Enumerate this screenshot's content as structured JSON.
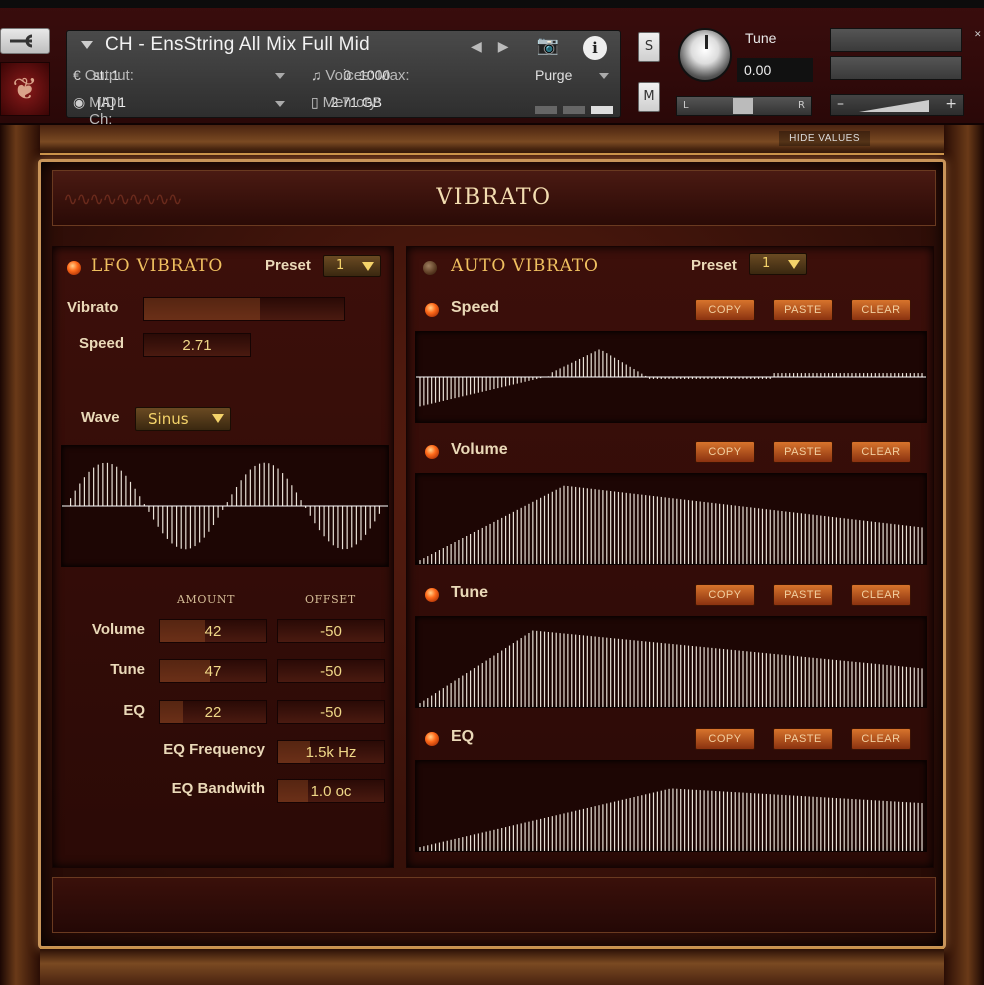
{
  "header": {
    "instrument_name": "CH - EnsString All Mix Full Mid",
    "output_label": "Output:",
    "output_value": "st. 1",
    "voices_label": "Voices:",
    "voices_value": "0",
    "max_label": "Max:",
    "max_value": "1000",
    "purge_label": "Purge",
    "midi_label": "MIDI Ch:",
    "midi_value": "[A]  1",
    "memory_label": "Memory:",
    "memory_value": "2.71 GB",
    "solo_label": "S",
    "mute_label": "M",
    "tune_label": "Tune",
    "tune_value": "0.00",
    "pan_left": "L",
    "pan_right": "R",
    "vol_minus": "–",
    "vol_plus": "+"
  },
  "hide_values_label": "HIDE VALUES",
  "page_title": "VIBRATO",
  "lfo": {
    "title": "LFO VIBRATO",
    "preset_label": "Preset",
    "preset_value": "1",
    "vibrato_label": "Vibrato",
    "vibrato_level": 0.58,
    "speed_label": "Speed",
    "speed_value": "2.71",
    "wave_label": "Wave",
    "wave_value": "Sinus",
    "amount_header": "AMOUNT",
    "offset_header": "OFFSET",
    "rows": [
      {
        "label": "Volume",
        "amount": "42",
        "offset": "-50"
      },
      {
        "label": "Tune",
        "amount": "47",
        "offset": "-50"
      },
      {
        "label": "EQ",
        "amount": "22",
        "offset": "-50"
      }
    ],
    "eq_freq_label": "EQ Frequency",
    "eq_freq_value": "1.5k Hz",
    "eq_bw_label": "EQ Bandwith",
    "eq_bw_value": "1.0 oc"
  },
  "auto": {
    "title": "AUTO VIBRATO",
    "preset_label": "Preset",
    "preset_value": "1",
    "copy_label": "COPY",
    "paste_label": "PASTE",
    "clear_label": "CLEAR",
    "sections": [
      {
        "label": "Speed"
      },
      {
        "label": "Volume"
      },
      {
        "label": "Tune"
      },
      {
        "label": "EQ"
      }
    ]
  },
  "colors": {
    "accent_gold": "#f0c060",
    "led_on": "#ff6a1a",
    "value_text": "#f0d888"
  }
}
